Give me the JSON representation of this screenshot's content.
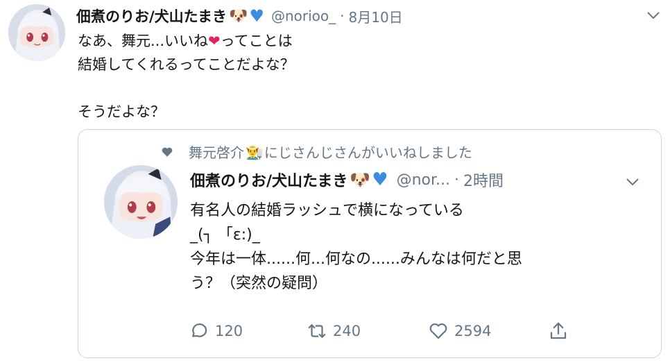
{
  "tweet": {
    "display_name": "佃煮のりお/犬山たまき",
    "name_emojis": [
      "dog-face-emoji",
      "blue-heart-emoji"
    ],
    "handle": "@norioo_",
    "separator": "·",
    "date": "8月10日",
    "text_line1_a": "なあ、舞元...いいね",
    "text_line1_heart": "❤",
    "text_line1_b": "ってことは",
    "text_line2": "結婚してくれるってことだよな？",
    "text_line3": "",
    "text_line4": "そうだよな？",
    "quoted": {
      "liked_by": "舞元啓介",
      "liked_by_emoji": "farmer-emoji",
      "liked_suffix": "にじさんじさんがいいねしました",
      "display_name": "佃煮のりお/犬山たまき",
      "handle": "@nor...",
      "separator": "·",
      "time": "2時間",
      "text_lines": [
        "有名人の結婚ラッシュで横になっている",
        "_(┐ 「ε:)_",
        "今年は一体......何...何なの......みんなは何だと思",
        "う？（突然の疑問）"
      ],
      "actions": {
        "reply_count": "120",
        "retweet_count": "240",
        "like_count": "2594"
      }
    }
  },
  "colors": {
    "text": "#14171a",
    "secondary": "#657786",
    "border": "#ccd6dd",
    "blue_heart": "#3a8de0",
    "red_heart": "#e0245e"
  }
}
